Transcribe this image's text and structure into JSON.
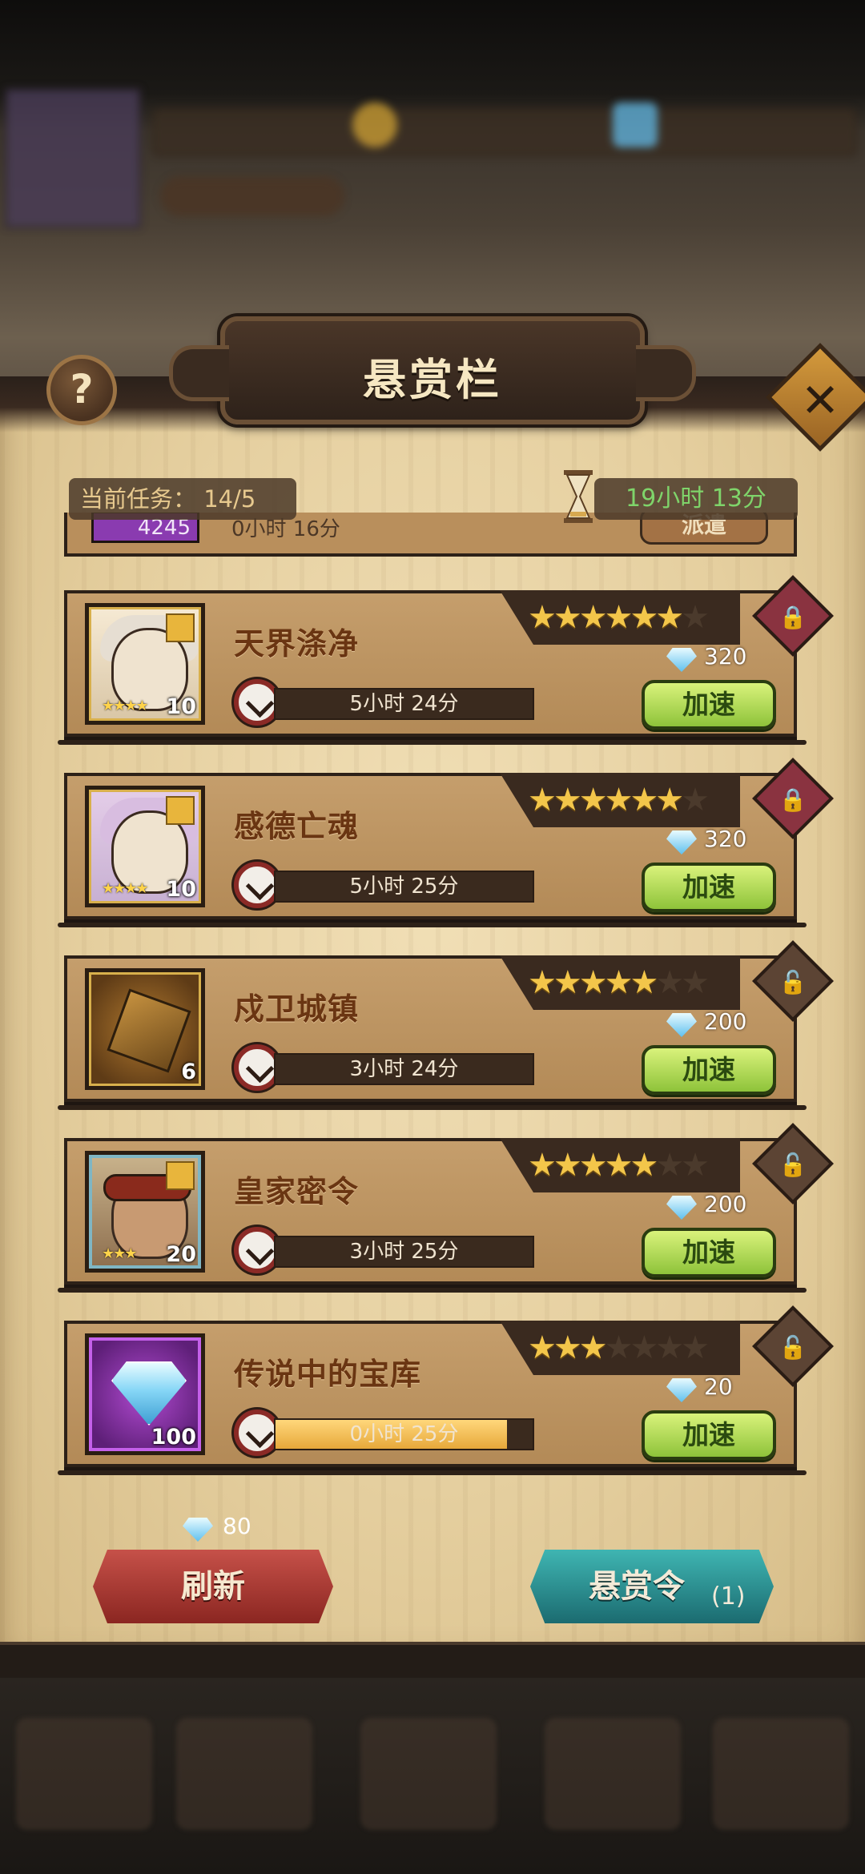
{
  "title": "悬赏栏",
  "status": {
    "current_task": "当前任务：  14/5",
    "timer": "19小时 13分"
  },
  "top_partial": {
    "value": "4245",
    "time": "0小时 16分",
    "button": "派遣"
  },
  "missions": [
    {
      "name": "天界涤净",
      "stars": 6,
      "max_stars": 7,
      "portrait_count": "10",
      "portrait_stars": "★★★★",
      "time": "5小时 24分",
      "progress": 0,
      "cost": "320",
      "button": "加速",
      "locked": true
    },
    {
      "name": "感德亡魂",
      "stars": 6,
      "max_stars": 7,
      "portrait_count": "10",
      "portrait_stars": "★★★★",
      "time": "5小时 25分",
      "progress": 0,
      "cost": "320",
      "button": "加速",
      "locked": true
    },
    {
      "name": "戍卫城镇",
      "stars": 5,
      "max_stars": 7,
      "portrait_count": "6",
      "portrait_stars": "",
      "time": "3小时 24分",
      "progress": 0,
      "cost": "200",
      "button": "加速",
      "locked": false
    },
    {
      "name": "皇家密令",
      "stars": 5,
      "max_stars": 7,
      "portrait_count": "20",
      "portrait_stars": "★★★",
      "time": "3小时 25分",
      "progress": 0,
      "cost": "200",
      "button": "加速",
      "locked": false
    },
    {
      "name": "传说中的宝库",
      "stars": 3,
      "max_stars": 7,
      "portrait_count": "100",
      "portrait_stars": "",
      "time": "0小时 25分",
      "progress": 0.9,
      "cost": "20",
      "button": "加速",
      "locked": false
    }
  ],
  "footer": {
    "refresh_cost": "80",
    "refresh_label": "刷新",
    "order_label": "悬赏令",
    "order_count": "(1)"
  },
  "icons": {
    "help": "?",
    "close": "✕",
    "lock_closed": "🔒",
    "lock_open": "🔓"
  }
}
